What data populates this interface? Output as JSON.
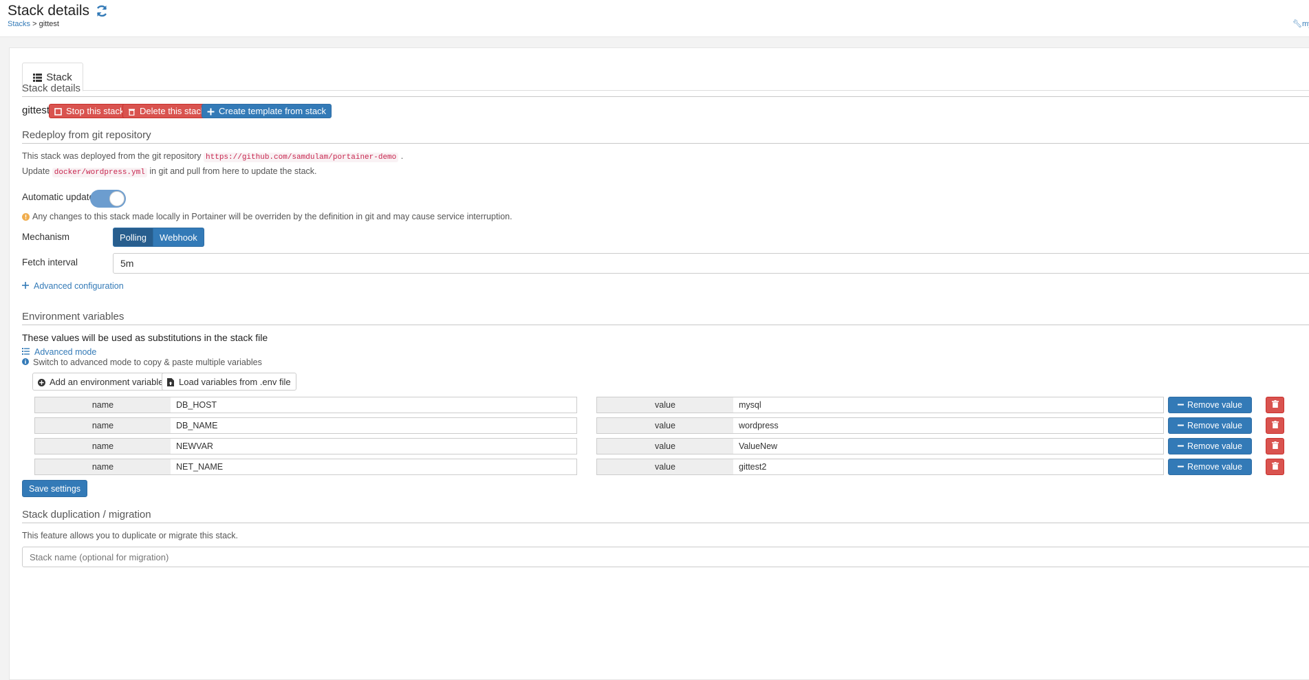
{
  "header": {
    "title": "Stack details",
    "breadcrumb_parent": "Stacks",
    "breadcrumb_sep": ">",
    "breadcrumb_current": "gittest",
    "right_link": "my account"
  },
  "tabs": [
    {
      "label": "Stack"
    }
  ],
  "stack_details": {
    "section_title": "Stack details",
    "stack_name": "gittest",
    "stop_label": "Stop this stack",
    "delete_label": "Delete this stack",
    "template_label": "Create template from stack"
  },
  "redeploy": {
    "section_title": "Redeploy from git repository",
    "deployed_prefix": "This stack was deployed from the git repository",
    "repo_url": "https://github.com/samdulam/portainer-demo",
    "deployed_suffix": ".",
    "update_prefix": "Update",
    "compose_file": "docker/wordpress.yml",
    "update_suffix": "in git and pull from here to update the stack.",
    "auto_updates_label": "Automatic updates",
    "auto_updates_on": true,
    "warning": "Any changes to this stack made locally in Portainer will be overriden by the definition in git and may cause service interruption.",
    "mechanism_label": "Mechanism",
    "mechanism_options": [
      "Polling",
      "Webhook"
    ],
    "mechanism_selected": "Polling",
    "fetch_interval_label": "Fetch interval",
    "fetch_interval_value": "5m",
    "advanced_config_label": "Advanced configuration"
  },
  "env": {
    "section_title": "Environment variables",
    "description": "These values will be used as substitutions in the stack file",
    "advanced_mode_label": "Advanced mode",
    "switch_hint": "Switch to advanced mode to copy & paste multiple variables",
    "add_label": "Add an environment variable",
    "load_label": "Load variables from .env file",
    "name_addon": "name",
    "value_addon": "value",
    "remove_label": "Remove value",
    "vars": [
      {
        "name": "DB_HOST",
        "value": "mysql"
      },
      {
        "name": "DB_NAME",
        "value": "wordpress"
      },
      {
        "name": "NEWVAR",
        "value": "ValueNew"
      },
      {
        "name": "NET_NAME",
        "value": "gittest2"
      }
    ],
    "save_label": "Save settings"
  },
  "duplication": {
    "section_title": "Stack duplication / migration",
    "description": "This feature allows you to duplicate or migrate this stack.",
    "input_placeholder": "Stack name (optional for migration)"
  },
  "colors": {
    "primary": "#337ab7",
    "danger": "#d9534f",
    "warning": "#f0ad4e"
  }
}
